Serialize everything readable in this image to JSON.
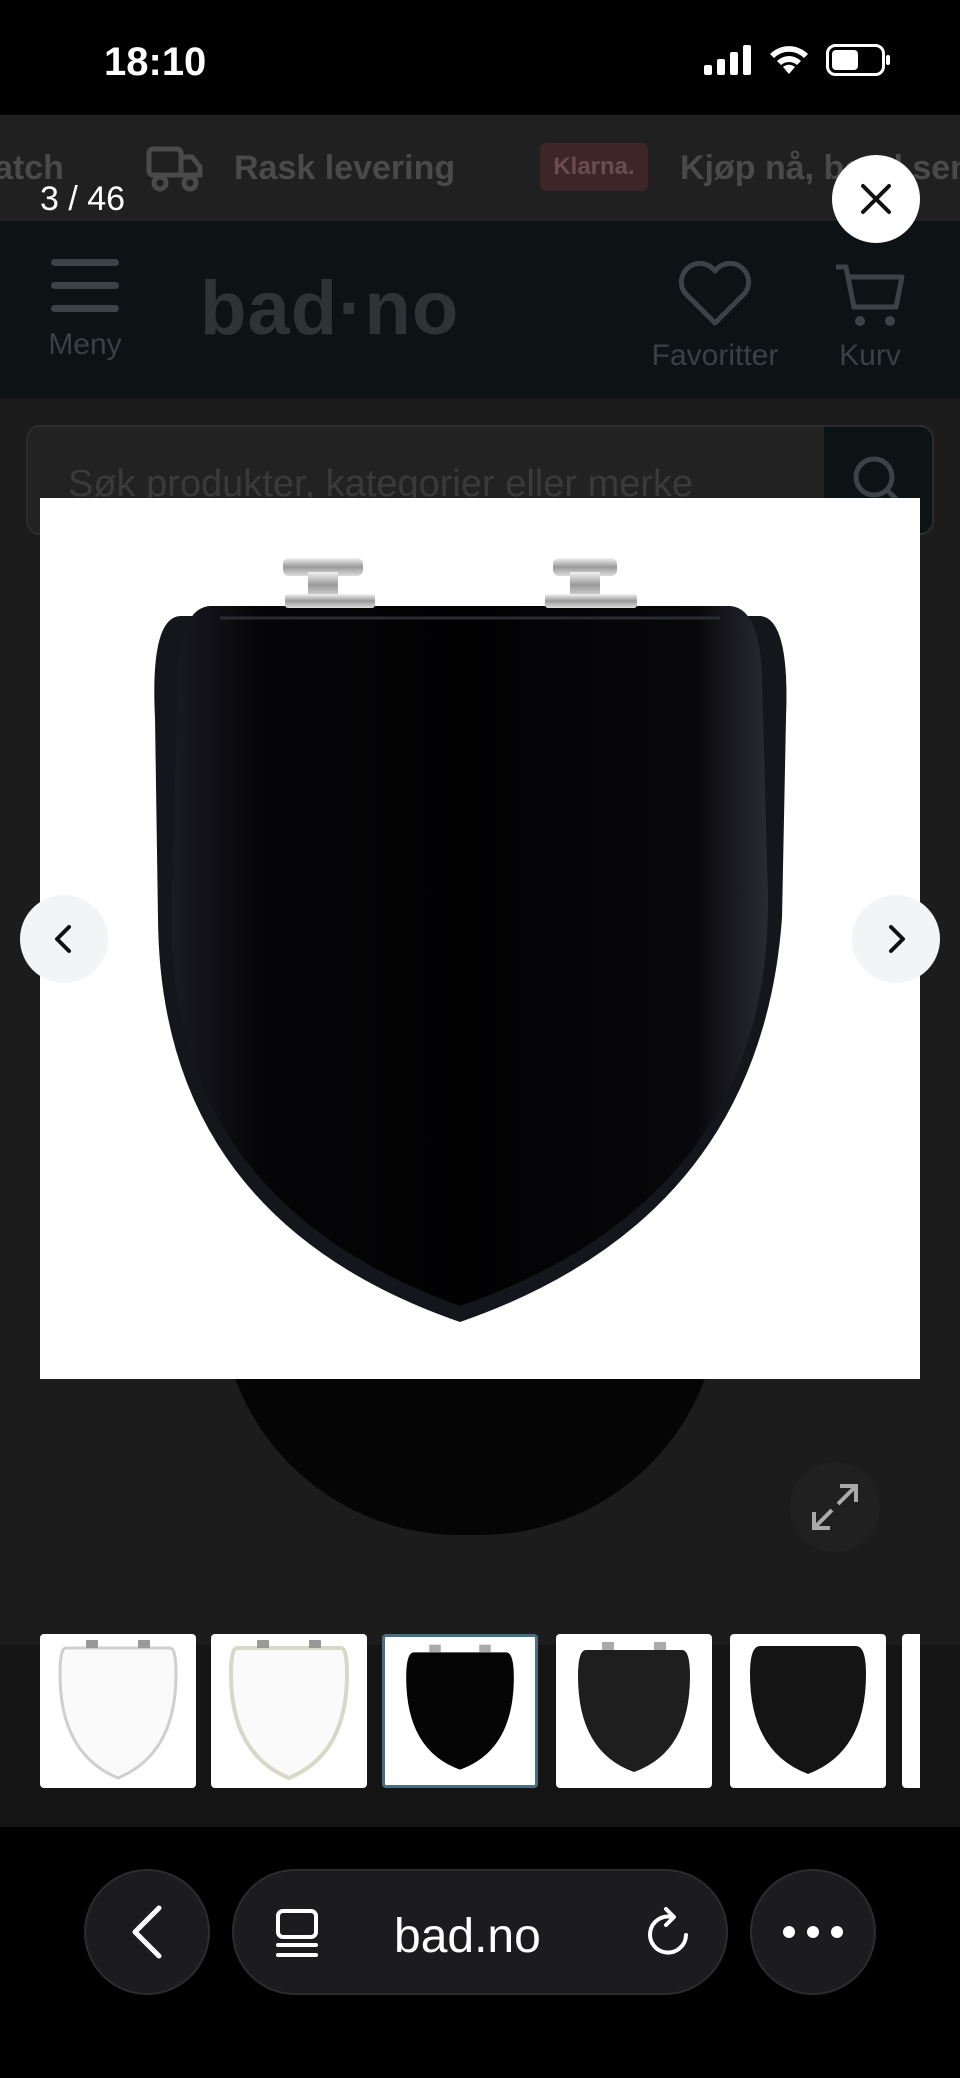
{
  "status_bar": {
    "time": "18:10"
  },
  "background_page": {
    "promo": {
      "item1": "atch",
      "item2": "Rask levering",
      "badge": "Klarna.",
      "item3": "Kjøp nå, betal senere"
    },
    "header": {
      "menu_label": "Meny",
      "logo": "bad·no",
      "favorites_label": "Favoritter",
      "cart_label": "Kurv"
    },
    "search": {
      "placeholder": "Søk produkter, kategorier eller merke"
    }
  },
  "gallery": {
    "counter": "3 / 46",
    "current_index": 3,
    "total": 46,
    "thumbnails": [
      {
        "color": "white",
        "active": false
      },
      {
        "color": "white",
        "active": false
      },
      {
        "color": "black",
        "active": true
      },
      {
        "color": "black",
        "active": false
      },
      {
        "color": "black",
        "active": false
      }
    ]
  },
  "browser": {
    "url": "bad.no"
  },
  "colors": {
    "overlay_bg": "#1c1c1c",
    "active_thumb_border": "#4a6d80",
    "klarna_pink": "#ffb3c7"
  }
}
